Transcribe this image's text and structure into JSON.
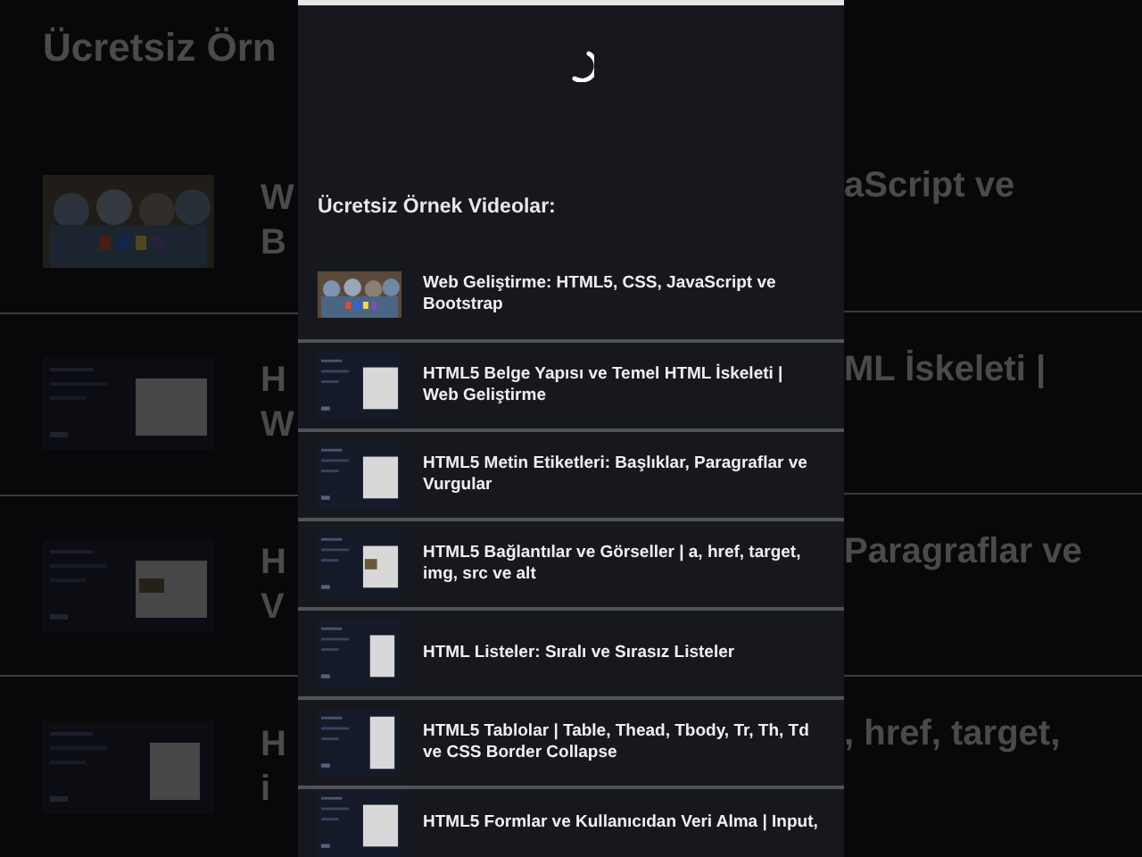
{
  "background": {
    "title": "Ücretsiz Örn",
    "rows": [
      {
        "left_lines": [
          "W",
          "B"
        ],
        "right_text": "aScript ve"
      },
      {
        "left_lines": [
          "H",
          "W"
        ],
        "right_text": "ML İskeleti |"
      },
      {
        "left_lines": [
          "H",
          "V"
        ],
        "right_text": "Paragraflar ve"
      },
      {
        "left_lines": [
          "H",
          "i"
        ],
        "right_text": ", href, target,"
      }
    ]
  },
  "dialog": {
    "title": "Ücretsiz Örnek Videolar:",
    "videos": [
      {
        "title": "Web Geliştirme: HTML5, CSS, JavaScript ve Bootstrap"
      },
      {
        "title": "HTML5 Belge Yapısı ve Temel HTML İskeleti | Web Geliştirme"
      },
      {
        "title": "HTML5 Metin Etiketleri: Başlıklar, Paragraflar ve Vurgular"
      },
      {
        "title": "HTML5 Bağlantılar ve Görseller | a, href, target, img, src ve alt"
      },
      {
        "title": "HTML Listeler: Sıralı ve Sırasız Listeler"
      },
      {
        "title": "HTML5 Tablolar | Table, Thead, Tbody, Tr, Th, Td ve CSS Border Collapse"
      },
      {
        "title": "HTML5 Formlar ve Kullanıcıdan Veri Alma | Input,"
      }
    ]
  }
}
